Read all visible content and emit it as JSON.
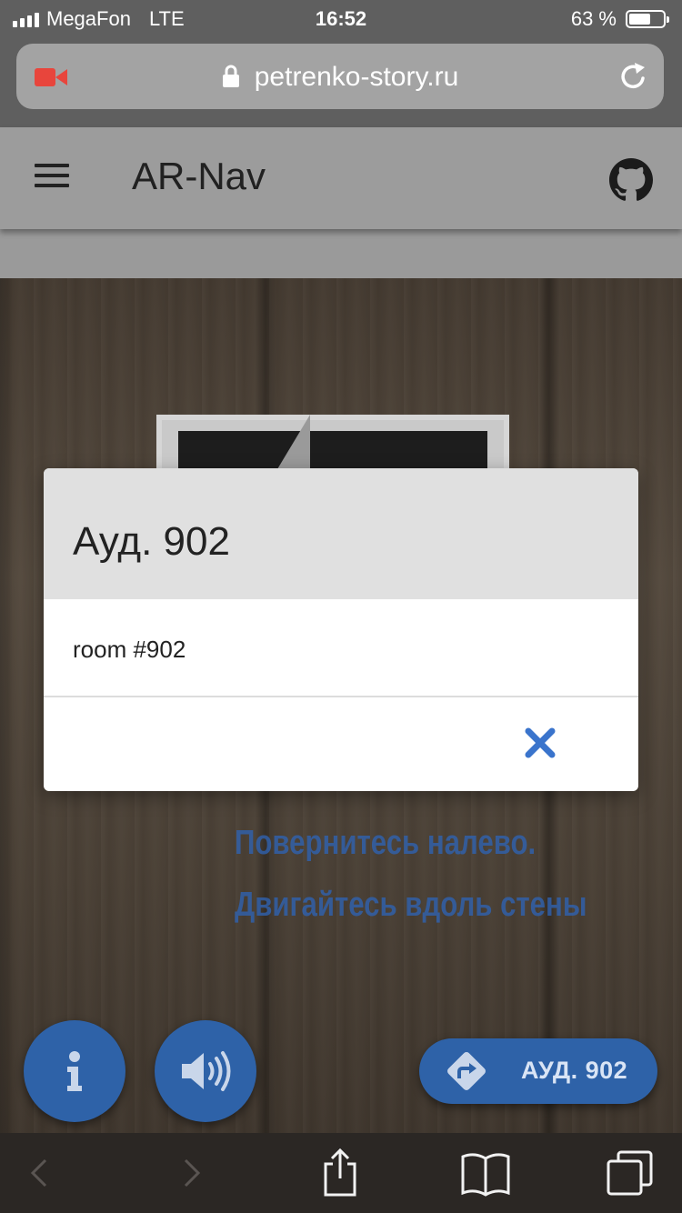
{
  "status_bar": {
    "carrier": "MegaFon",
    "network": "LTE",
    "time": "16:52",
    "battery": "63 %",
    "battery_level": 0.63
  },
  "browser": {
    "url": "petrenko-story.ru",
    "icons": [
      "screen-record-icon",
      "lock-icon",
      "reload-icon"
    ]
  },
  "app_bar": {
    "title": "AR-Nav",
    "icons": [
      "menu-icon",
      "github-icon"
    ]
  },
  "ar_view": {
    "instruction_line1": "Повернитесь налево.",
    "instruction_line2": "Двигайтесь вдоль стены",
    "route_button_label": "АУД. 902",
    "icons": [
      "info-icon",
      "volume-icon",
      "directions-icon"
    ]
  },
  "modal": {
    "title": "Ауд. 902",
    "body": "room #902",
    "close_icon": "close-icon"
  },
  "bottom_toolbar": {
    "icons": [
      "back-icon",
      "forward-icon",
      "share-icon",
      "bookmarks-icon",
      "tabs-icon"
    ]
  },
  "colors": {
    "accent": "#2e62a8",
    "close_x": "#3a74cc",
    "recording": "#e8453c"
  }
}
